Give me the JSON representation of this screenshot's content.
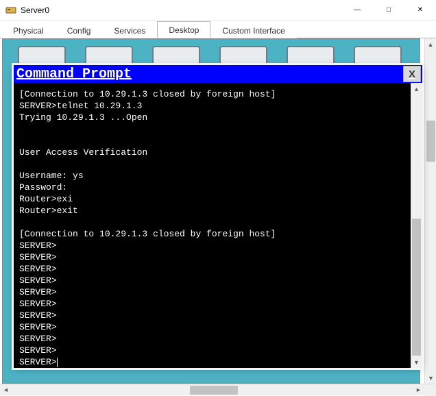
{
  "window": {
    "title": "Server0",
    "buttons": {
      "min": "—",
      "max": "□",
      "close": "✕"
    }
  },
  "tabs": [
    {
      "label": "Physical",
      "active": false
    },
    {
      "label": "Config",
      "active": false
    },
    {
      "label": "Services",
      "active": false
    },
    {
      "label": "Desktop",
      "active": true
    },
    {
      "label": "Custom Interface",
      "active": false
    }
  ],
  "cmd": {
    "title": "Command Prompt",
    "close": "X",
    "lines": [
      "[Connection to 10.29.1.3 closed by foreign host]",
      "SERVER>telnet 10.29.1.3",
      "Trying 10.29.1.3 ...Open",
      "",
      "",
      "User Access Verification",
      "",
      "Username: ys",
      "Password: ",
      "Router>exi",
      "Router>exit",
      "",
      "[Connection to 10.29.1.3 closed by foreign host]",
      "SERVER>",
      "SERVER>",
      "SERVER>",
      "SERVER>",
      "SERVER>",
      "SERVER>",
      "SERVER>",
      "SERVER>",
      "SERVER>",
      "SERVER>",
      "SERVER>"
    ],
    "prompt_last": "SERVER>"
  },
  "scroll": {
    "up": "▲",
    "down": "▼",
    "left": "◄",
    "right": "►"
  }
}
